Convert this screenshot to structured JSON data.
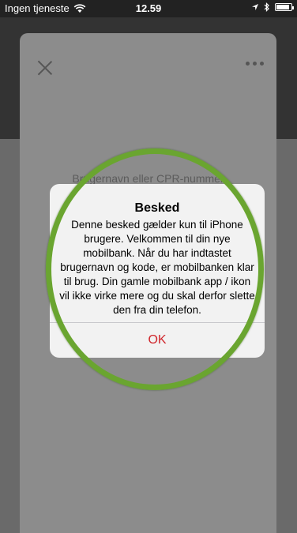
{
  "status_bar": {
    "carrier": "Ingen tjeneste",
    "time": "12.59",
    "icons": [
      "wifi-icon",
      "location-icon",
      "bluetooth-icon",
      "battery-icon"
    ]
  },
  "screen": {
    "field_placeholder": "Brugernavn eller CPR-nummer",
    "close_icon": "close-icon",
    "more_icon": "more-icon"
  },
  "alert": {
    "title": "Besked",
    "message": "Denne besked gælder kun til iPhone brugere. Velkommen til din nye mobilbank. Når du har indtastet brugernavn og kode, er mobilbanken klar til brug. Din gamle mobilbank app / ikon vil ikke virke mere og du skal derfor slette den fra din telefon.",
    "ok_label": "OK"
  },
  "colors": {
    "ok_text": "#d0262c",
    "highlight_ring": "#6aa530"
  }
}
